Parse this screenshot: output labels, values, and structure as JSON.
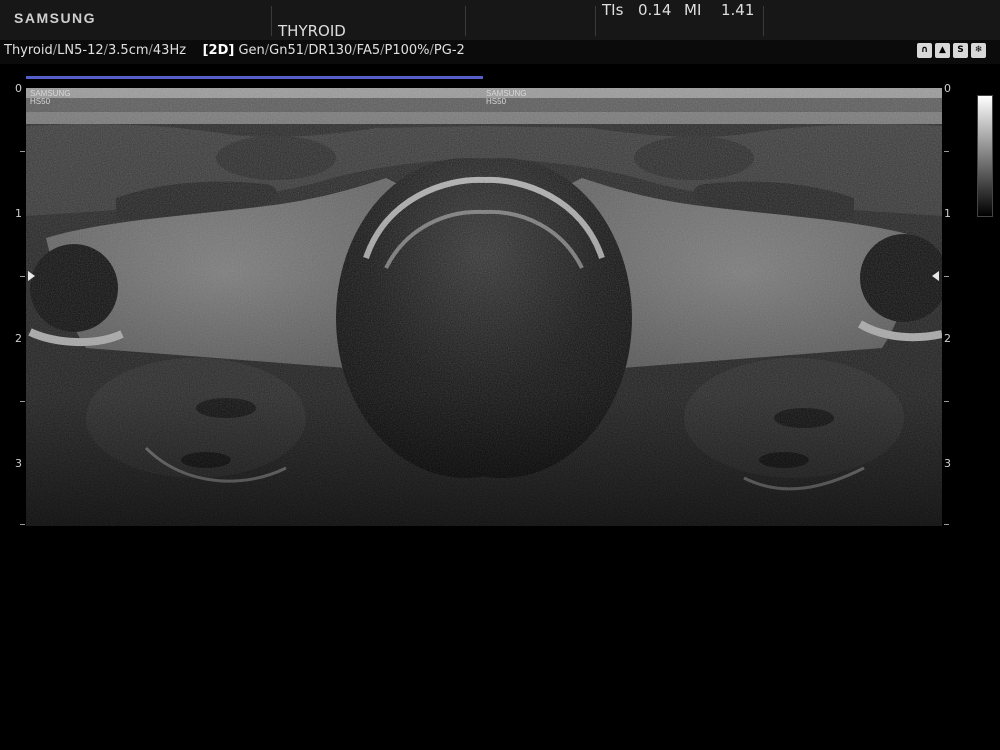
{
  "header": {
    "brand": "SAMSUNG",
    "preset": "THYROID",
    "tis_label": "TIs",
    "tis_value": "0.14",
    "mi_label": "MI",
    "mi_value": "1.41"
  },
  "params": {
    "app": "Thyroid",
    "probe": "LN5-12",
    "depth": "3.5cm",
    "frame_rate": "43Hz",
    "mode": "[2D]",
    "freq": "Gen",
    "gain": "Gn51",
    "dynamic_range": "DR130",
    "frame_avg": "FA5",
    "power": "P100%",
    "pg": "PG-2"
  },
  "icons": [
    {
      "name": "probe-icon",
      "glyph": "∩"
    },
    {
      "name": "body-mark-icon",
      "glyph": "▲"
    },
    {
      "name": "harmonic-icon",
      "glyph": "S"
    },
    {
      "name": "freeze-icon",
      "glyph": "❄"
    }
  ],
  "panes": {
    "left_label_line1": "SAMSUNG",
    "left_label_line2": "HS50",
    "right_label_line1": "SAMSUNG",
    "right_label_line2": "HS50"
  },
  "depth_scale": {
    "left": [
      "0",
      "1",
      "2",
      "3"
    ],
    "right": [
      "0",
      "1",
      "2",
      "3"
    ]
  },
  "colors": {
    "focus_line": "#5460c8",
    "background": "#000000"
  }
}
